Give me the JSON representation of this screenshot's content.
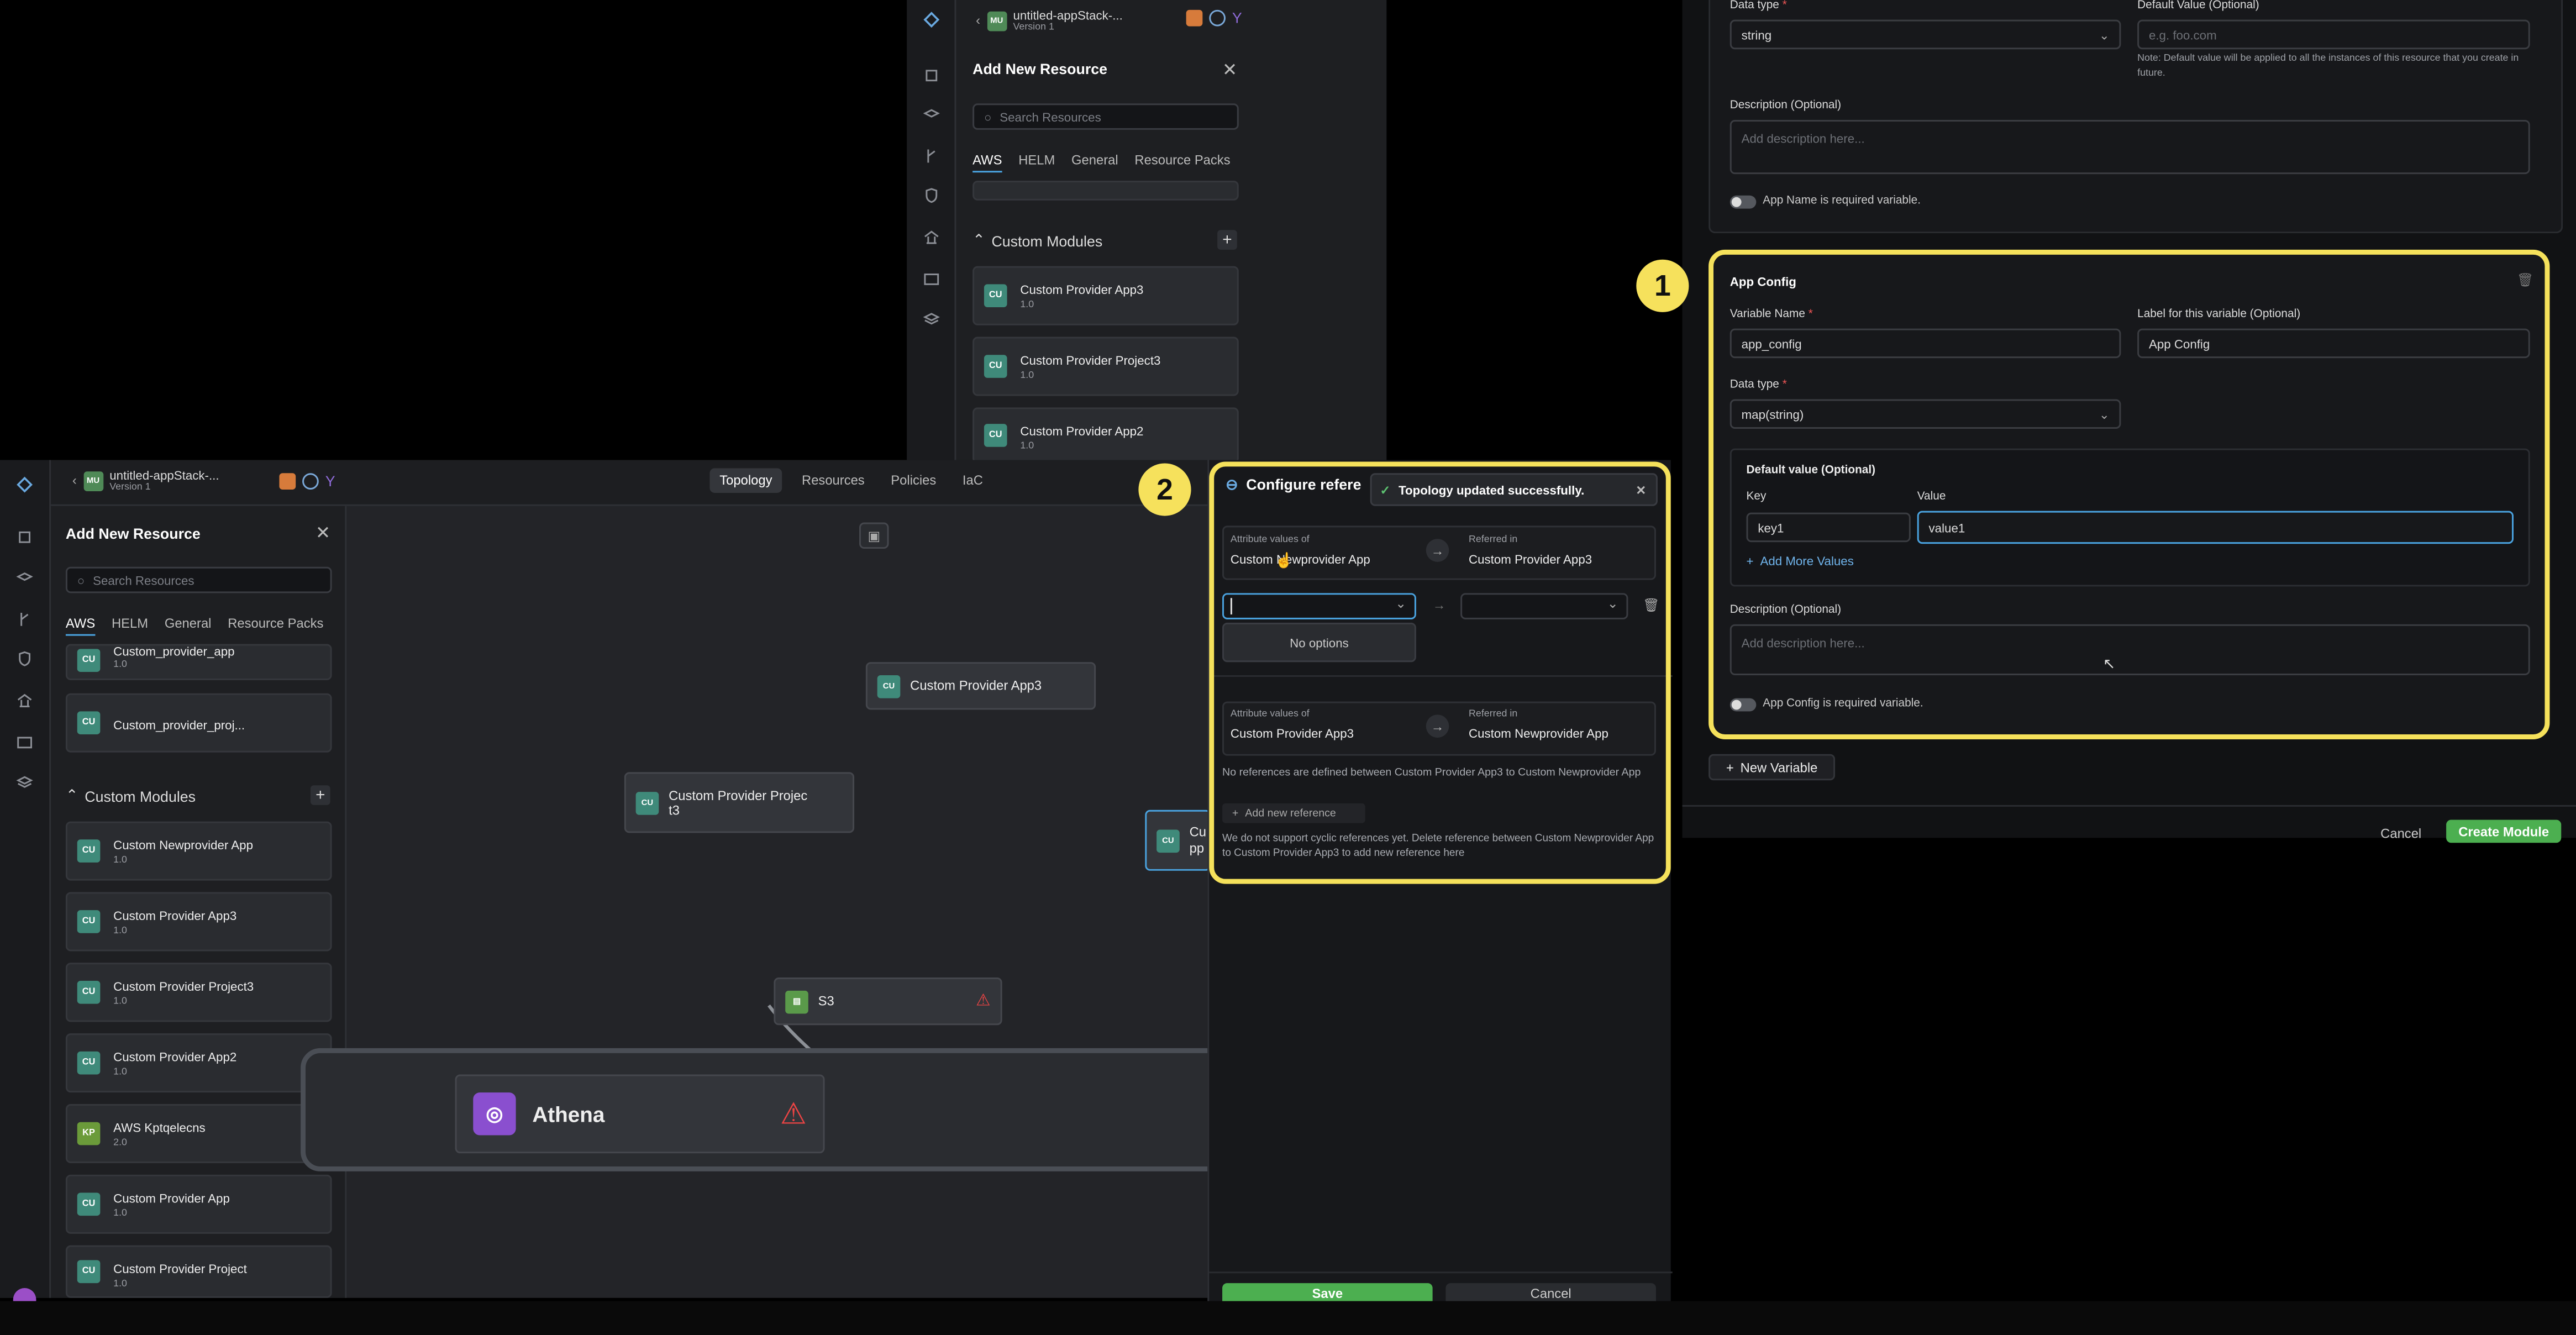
{
  "top_window": {
    "app_badge": "MU",
    "app_name": "untitled-appStack-...",
    "version": "Version 1",
    "panel_title": "Add New Resource",
    "search_placeholder": "Search Resources",
    "tabs": [
      "AWS",
      "HELM",
      "General",
      "Resource Packs"
    ],
    "section": "Custom Modules",
    "items": [
      {
        "badge": "CU",
        "name": "Custom Provider App3",
        "version": "1.0"
      },
      {
        "badge": "CU",
        "name": "Custom Provider Project3",
        "version": "1.0"
      },
      {
        "badge": "CU",
        "name": "Custom Provider App2",
        "version": "1.0"
      }
    ]
  },
  "form": {
    "data_type_label": "Data type",
    "data_type_value": "string",
    "default_value_label": "Default Value (Optional)",
    "default_value_placeholder": "e.g. foo.com",
    "default_note": "Note: Default value will be applied to all the instances of this resource that you create in future.",
    "description_label": "Description (Optional)",
    "description_placeholder": "Add description here...",
    "app_name_required": "App Name is required variable.",
    "block": {
      "title": "App Config",
      "var_name_label": "Variable Name",
      "var_name_value": "app_config",
      "label_label": "Label for this variable (Optional)",
      "label_value": "App Config",
      "data_type_label": "Data type",
      "data_type_value": "map(string)",
      "default_label": "Default value (Optional)",
      "key_label": "Key",
      "value_label": "Value",
      "key_value": "key1",
      "value_value": "value1",
      "add_more": "Add More Values",
      "description_label": "Description (Optional)",
      "description_placeholder": "Add description here...",
      "required_text": "App Config is required variable."
    },
    "new_variable": "New Variable",
    "cancel": "Cancel",
    "create": "Create Module"
  },
  "callouts": {
    "one": "1",
    "two": "2"
  },
  "main_window": {
    "app_badge": "MU",
    "app_name": "untitled-appStack-...",
    "version": "Version 1",
    "nav_tabs": [
      "Topology",
      "Resources",
      "Policies",
      "IaC"
    ],
    "panel_title": "Add New Resource",
    "search_placeholder": "Search Resources",
    "tabs": [
      "AWS",
      "HELM",
      "General",
      "Resource Packs"
    ],
    "top_items": [
      {
        "badge": "CU",
        "name": "Custom_provider_app",
        "version": "1.0"
      },
      {
        "badge": "CU",
        "name": "Custom_provider_proj...",
        "version": ""
      }
    ],
    "section": "Custom Modules",
    "items": [
      {
        "badge": "CU",
        "name": "Custom Newprovider App",
        "version": "1.0"
      },
      {
        "badge": "CU",
        "name": "Custom Provider App3",
        "version": "1.0"
      },
      {
        "badge": "CU",
        "name": "Custom Provider Project3",
        "version": "1.0"
      },
      {
        "badge": "CU",
        "name": "Custom Provider App2",
        "version": "1.0"
      },
      {
        "badge": "KP",
        "name": "AWS Kptqelecns",
        "version": "2.0"
      },
      {
        "badge": "CU",
        "name": "Custom Provider App",
        "version": "1.0"
      },
      {
        "badge": "CU",
        "name": "Custom Provider Project",
        "version": "1.0"
      }
    ],
    "canvas_nodes": {
      "app3": "Custom Provider App3",
      "proj_line1": "Custom Provider Projec",
      "proj_line2": "t3",
      "partial_line1": "Cu",
      "partial_line2": "pp",
      "s3": "S3",
      "athena": "Athena"
    }
  },
  "config_ref": {
    "title": "Configure refere",
    "toast": "Topology updated successfully.",
    "row1": {
      "left_label": "Attribute values of",
      "left_value": "Custom Newprovider App",
      "right_label": "Referred in",
      "right_value": "Custom Provider App3"
    },
    "no_options": "No options",
    "row2": {
      "left_label": "Attribute values of",
      "left_value": "Custom Provider App3",
      "right_label": "Referred in",
      "right_value": "Custom Newprovider App"
    },
    "no_refs": "No references are defined between Custom Provider App3 to Custom Newprovider App",
    "add_ref": "Add new reference",
    "cyclic_note": "We do not support cyclic references yet. Delete reference between Custom Newprovider App to Custom Provider App3 to add new reference here",
    "save": "Save",
    "cancel": "Cancel"
  },
  "colors": {
    "accent": "#4aa3e0",
    "highlight": "#f5e15b",
    "save": "#4caf50"
  }
}
